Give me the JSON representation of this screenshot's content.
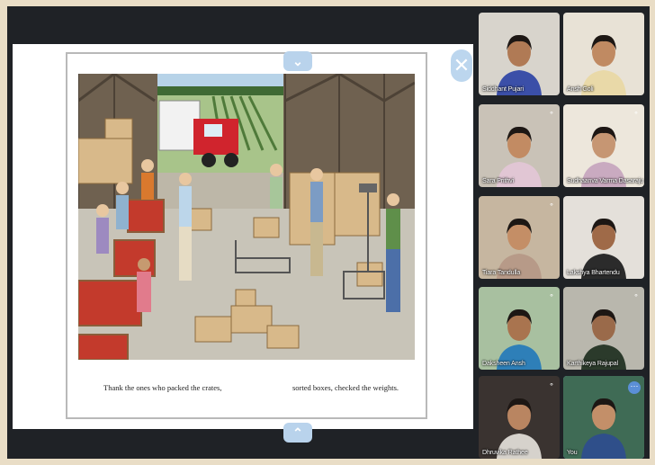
{
  "presentation": {
    "caption_left": "Thank the ones who packed the crates,",
    "caption_right": "sorted boxes, checked the weights.",
    "nav_up_icon": "chevron-up-icon",
    "nav_down_icon": "chevron-down-icon",
    "close_icon": "close-icon"
  },
  "participants": [
    {
      "name": "Siddhant Pujari",
      "bg": "#d8d4cc",
      "skin": "#b07a55",
      "shirt": "#3b4fa8",
      "muted": false
    },
    {
      "name": "Ansh Goli",
      "bg": "#e8e2d6",
      "skin": "#c08a62",
      "shirt": "#e9d9a8",
      "muted": false
    },
    {
      "name": "Sara Prithvi",
      "bg": "#c9c2b7",
      "skin": "#c28b63",
      "shirt": "#e1c6d4",
      "muted": true
    },
    {
      "name": "Sudhaanva Varma Dasaraju",
      "bg": "#ede7dc",
      "skin": "#c69673",
      "shirt": "#c9aac0",
      "muted": true
    },
    {
      "name": "Tiara Tandulla",
      "bg": "#c6b6a0",
      "skin": "#c48e66",
      "shirt": "#b79a88",
      "muted": true
    },
    {
      "name": "Lakshya Bhartendu",
      "bg": "#e4e0da",
      "skin": "#9f6a48",
      "shirt": "#2b2b2b",
      "muted": false
    },
    {
      "name": "Daksheen Ansh",
      "bg": "#a8c0a0",
      "skin": "#a9744f",
      "shirt": "#2e7fb8",
      "muted": true
    },
    {
      "name": "Karthikeya Rajupal",
      "bg": "#b9b7ad",
      "skin": "#9a6a4a",
      "shirt": "#2b3a2b",
      "muted": true
    },
    {
      "name": "Dhruvika Rathee",
      "bg": "#3a3330",
      "skin": "#b98561",
      "shirt": "#d6d2cc",
      "muted": true
    },
    {
      "name": "You",
      "bg": "#3f6b55",
      "skin": "#c38f69",
      "shirt": "#2f4f8a",
      "muted": false
    }
  ]
}
